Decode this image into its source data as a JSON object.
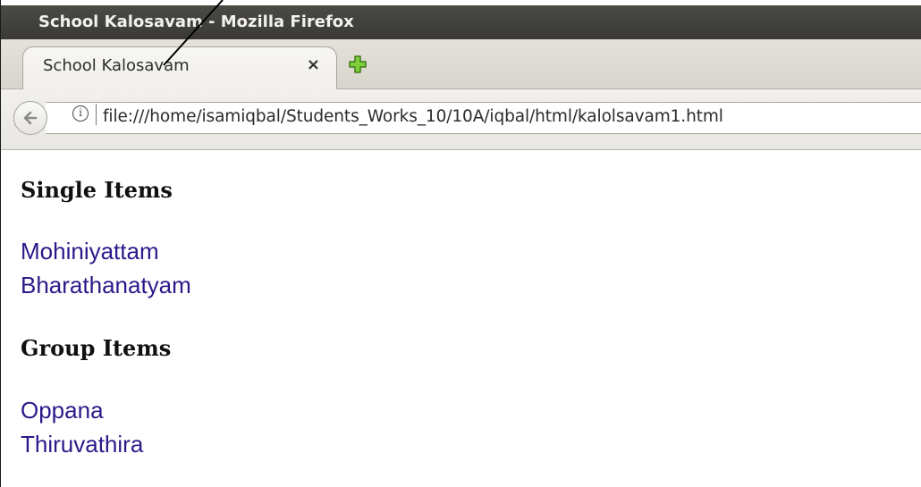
{
  "window": {
    "title": "School Kalosavam - Mozilla Firefox"
  },
  "tabs": [
    {
      "label": "School Kalosavam",
      "close": "×"
    }
  ],
  "urlbar": {
    "url": "file:///home/isamiqbal/Students_Works_10/10A/iqbal/html/kalolsavam1.html",
    "info": "i"
  },
  "page": {
    "sections": [
      {
        "heading": "Single Items",
        "items": [
          "Mohiniyattam",
          "Bharathanatyam"
        ]
      },
      {
        "heading": "Group Items",
        "items": [
          "Oppana",
          "Thiruvathira"
        ]
      }
    ]
  },
  "icons": {
    "back": "back-arrow-icon",
    "new_tab": "plus-icon",
    "info": "info-icon"
  },
  "colors": {
    "titlebar": "#3f3e3a",
    "link": "#2a1a8a",
    "new_tab_icon": "#6fbf2a"
  }
}
